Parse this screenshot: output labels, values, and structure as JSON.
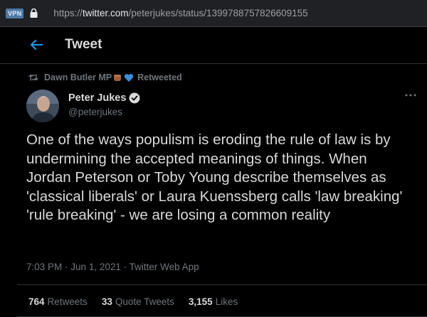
{
  "browser": {
    "vpn_label": "VPN",
    "url_scheme": "https://",
    "url_domain": "twitter.com",
    "url_path": "/peterjukes/status/1399788757826609155"
  },
  "header": {
    "title": "Tweet"
  },
  "retweet": {
    "retweeter": "Dawn Butler MP",
    "label": "Retweeted"
  },
  "author": {
    "name": "Peter Jukes",
    "handle": "@peterjukes"
  },
  "tweet": {
    "text": "One of the ways populism is eroding the rule of law is by undermining the accepted meanings of things. When Jordan Peterson or Toby Young describe themselves as 'classical liberals' or Laura Kuenssberg calls 'law breaking' 'rule breaking' - we are losing a common reality",
    "time": "7:03 PM",
    "date": "Jun 1, 2021",
    "source": "Twitter Web App"
  },
  "stats": {
    "retweets_count": "764",
    "retweets_label": "Retweets",
    "quotes_count": "33",
    "quotes_label": "Quote Tweets",
    "likes_count": "3,155",
    "likes_label": "Likes"
  },
  "colors": {
    "background": "#000000",
    "accent": "#1d9bf0",
    "text": "#d9d9d9",
    "secondary_text": "#6e767d"
  }
}
